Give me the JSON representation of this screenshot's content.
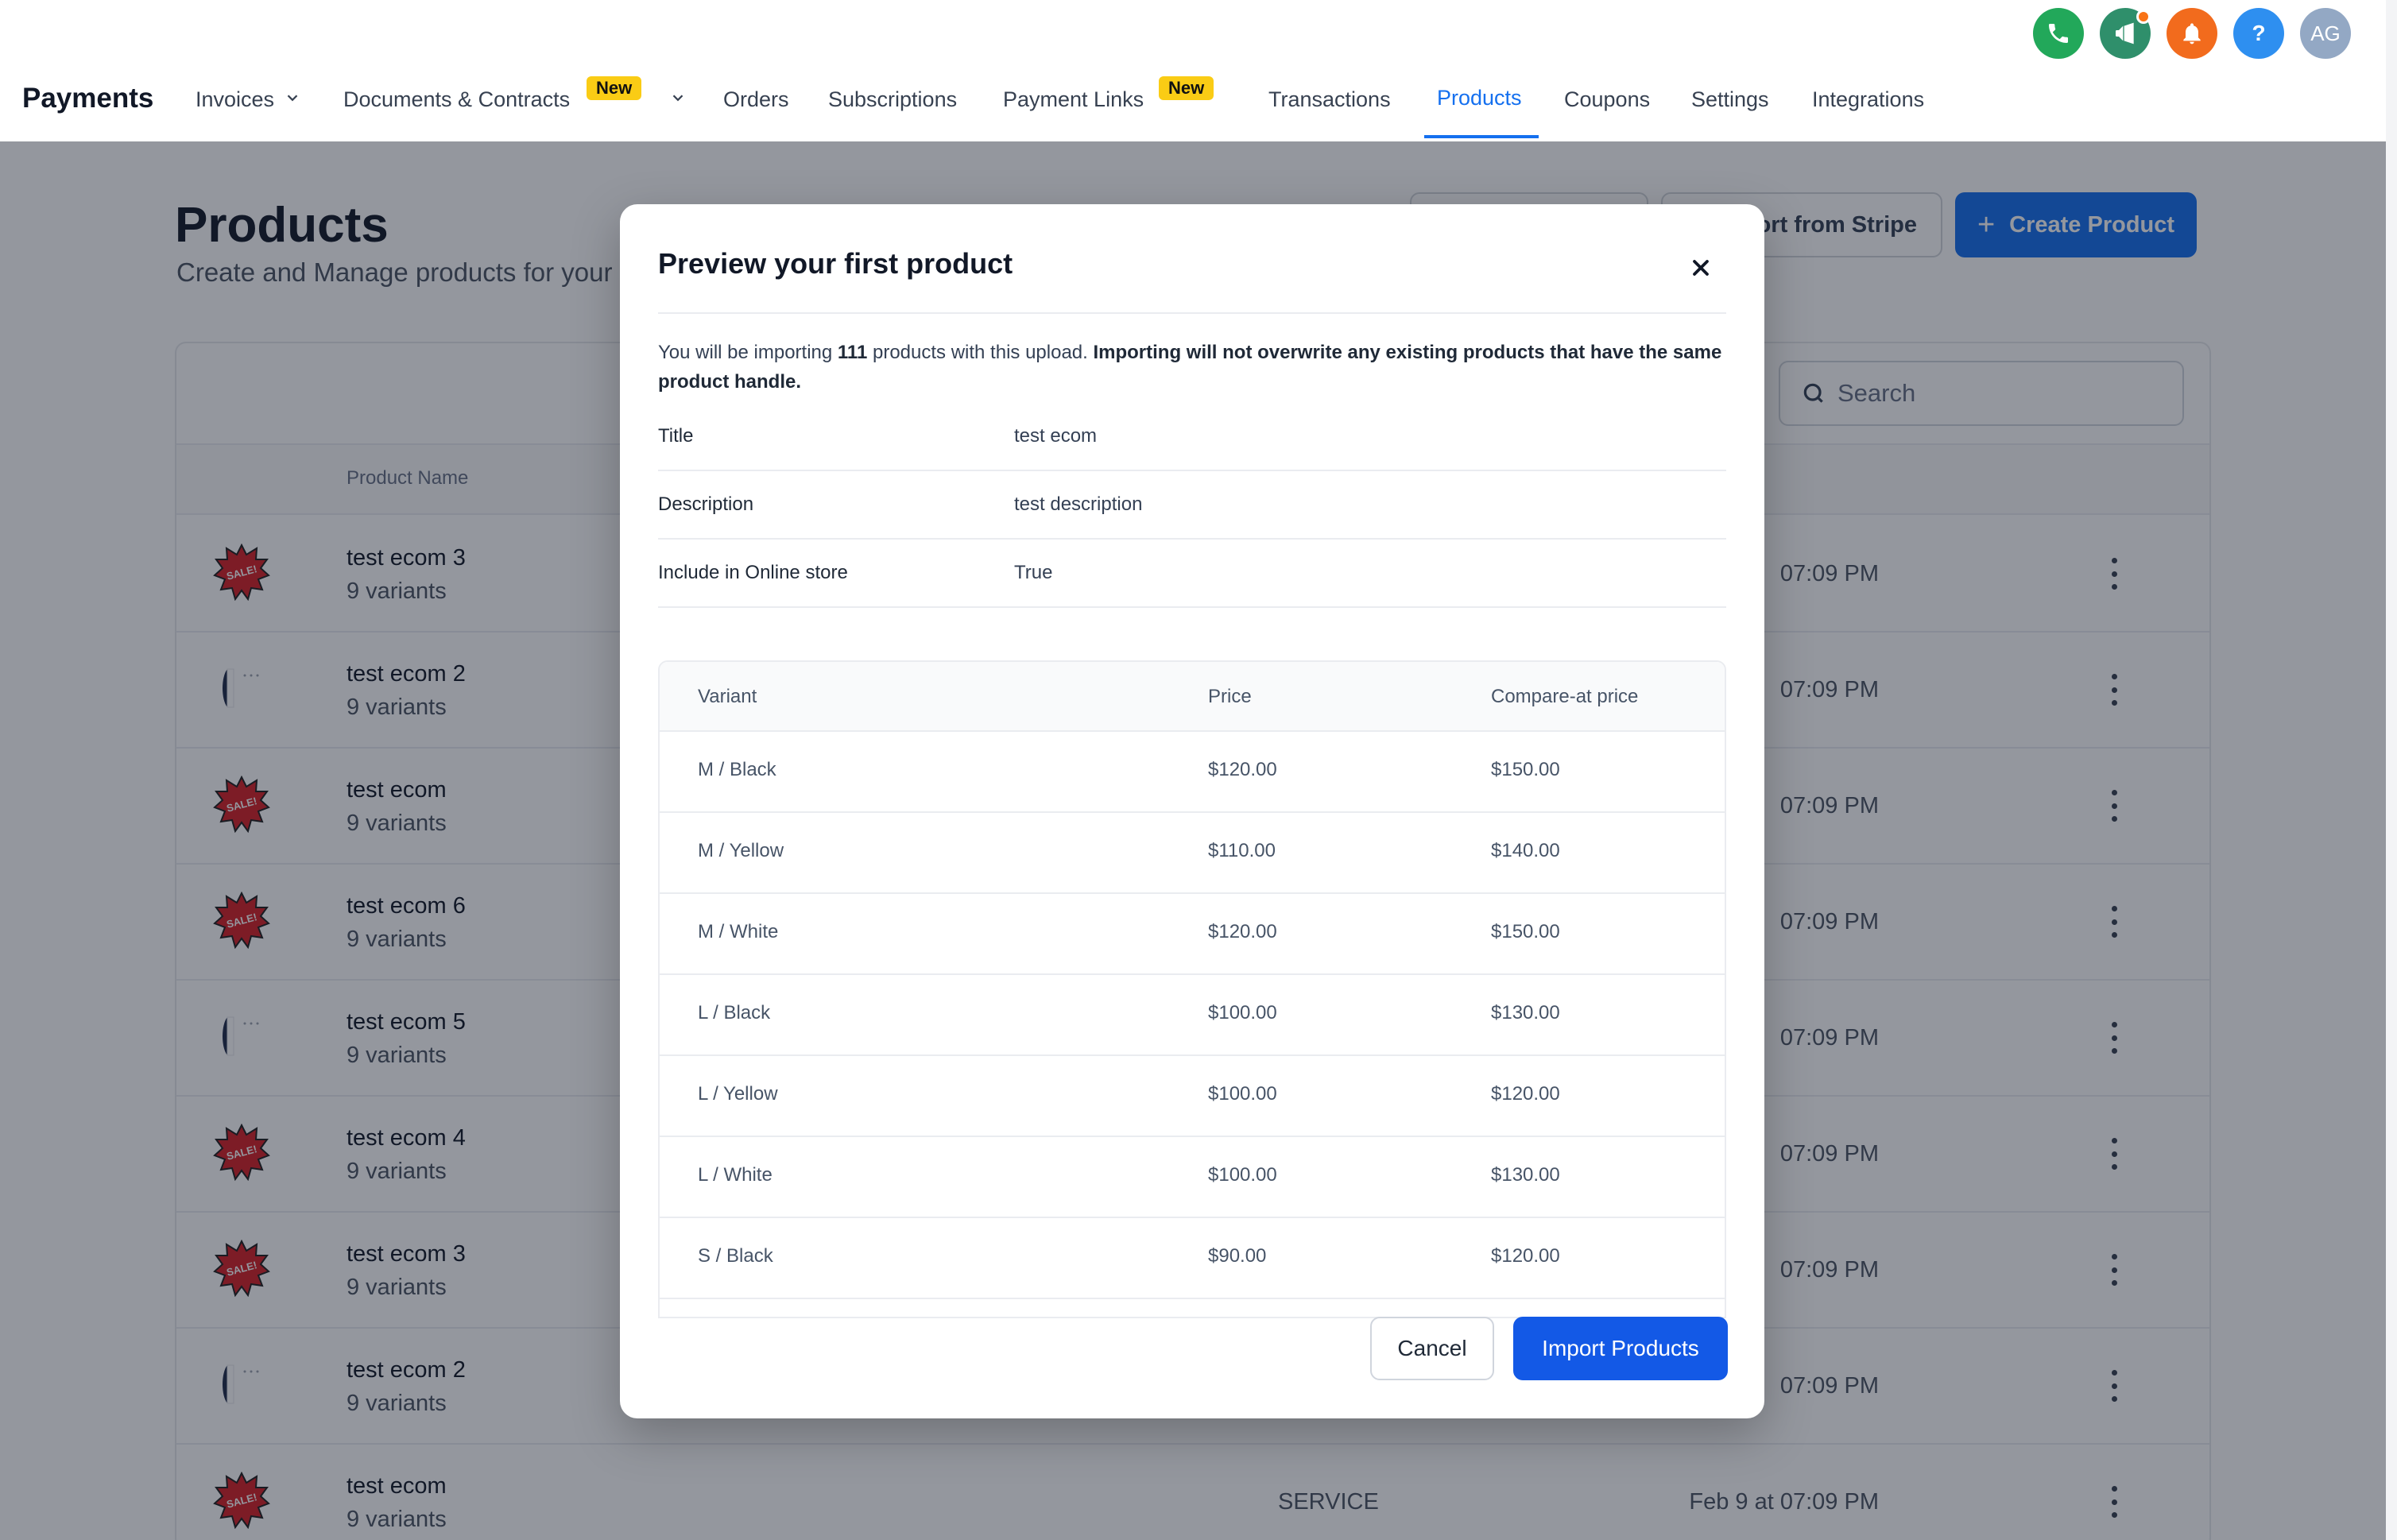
{
  "header": {
    "brand": "Payments",
    "avatar_initials": "AG",
    "icons": [
      "phone-icon",
      "megaphone-icon",
      "bell-icon",
      "help-icon"
    ],
    "nav": {
      "invoices": "Invoices",
      "documents": "Documents & Contracts",
      "new_badge": "New",
      "orders": "Orders",
      "subscriptions": "Subscriptions",
      "payment_links": "Payment Links",
      "transactions": "Transactions",
      "products": "Products",
      "coupons": "Coupons",
      "settings": "Settings",
      "integrations": "Integrations"
    },
    "active_tab": "Products",
    "colors": {
      "accent": "#1570ef",
      "phone": "#22a85a",
      "megaphone": "#2f8f6b",
      "bell": "#f26b1d",
      "help": "#2e8ff0"
    }
  },
  "page": {
    "title": "Products",
    "subtitle": "Create and Manage products for your",
    "import_stripe_label": "ort from Stripe",
    "create_product_label": "Create Product",
    "search_placeholder": "Search",
    "col_product_name": "Product Name",
    "rows": [
      {
        "name": "test ecom 3",
        "variants": "9 variants",
        "type": "",
        "date": "07:09 PM",
        "thumb": "sale"
      },
      {
        "name": "test ecom 2",
        "variants": "9 variants",
        "type": "",
        "date": "07:09 PM",
        "thumb": "shirt"
      },
      {
        "name": "test ecom",
        "variants": "9 variants",
        "type": "",
        "date": "07:09 PM",
        "thumb": "sale"
      },
      {
        "name": "test ecom 6",
        "variants": "9 variants",
        "type": "",
        "date": "07:09 PM",
        "thumb": "sale"
      },
      {
        "name": "test ecom 5",
        "variants": "9 variants",
        "type": "",
        "date": "07:09 PM",
        "thumb": "shirt"
      },
      {
        "name": "test ecom 4",
        "variants": "9 variants",
        "type": "",
        "date": "07:09 PM",
        "thumb": "sale"
      },
      {
        "name": "test ecom 3",
        "variants": "9 variants",
        "type": "",
        "date": "07:09 PM",
        "thumb": "sale"
      },
      {
        "name": "test ecom 2",
        "variants": "9 variants",
        "type": "",
        "date": "07:09 PM",
        "thumb": "shirt"
      },
      {
        "name": "test ecom",
        "variants": "9 variants",
        "type": "SERVICE",
        "date": "Feb 9 at 07:09 PM",
        "thumb": "sale"
      }
    ]
  },
  "modal": {
    "title": "Preview your first product",
    "intro_prefix": "You will be importing ",
    "intro_count": "111",
    "intro_middle": " products with this upload. ",
    "intro_bold": "Importing will not overwrite any existing products that have the same product handle.",
    "fields": [
      {
        "label": "Title",
        "value": "test ecom"
      },
      {
        "label": "Description",
        "value": "test description"
      },
      {
        "label": "Include in Online store",
        "value": "True"
      }
    ],
    "table": {
      "headers": [
        "Variant",
        "Price",
        "Compare-at price"
      ],
      "rows": [
        [
          "M / Black",
          "$120.00",
          "$150.00"
        ],
        [
          "M / Yellow",
          "$110.00",
          "$140.00"
        ],
        [
          "M / White",
          "$120.00",
          "$150.00"
        ],
        [
          "L / Black",
          "$100.00",
          "$130.00"
        ],
        [
          "L / Yellow",
          "$100.00",
          "$120.00"
        ],
        [
          "L / White",
          "$100.00",
          "$130.00"
        ],
        [
          "S / Black",
          "$90.00",
          "$120.00"
        ]
      ]
    },
    "cancel_label": "Cancel",
    "import_label": "Import Products"
  }
}
